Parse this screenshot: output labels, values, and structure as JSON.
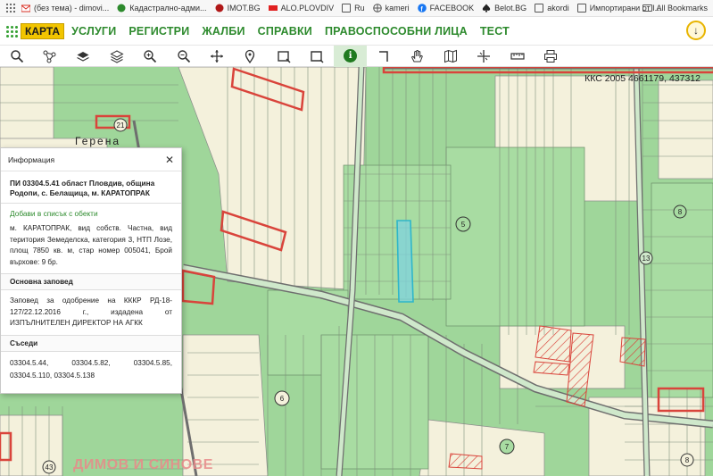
{
  "bookmarks": {
    "items": [
      {
        "label": "(без тема) - dimovi...",
        "icon": "gmail-icon"
      },
      {
        "label": "Кадастрално-адми...",
        "icon": "cadastre-icon"
      },
      {
        "label": "IMOT.BG",
        "icon": "imot-icon"
      },
      {
        "label": "ALO.PLOVDIV",
        "icon": "alo-icon"
      },
      {
        "label": "Ru",
        "icon": "folder-icon"
      },
      {
        "label": "kameri",
        "icon": "globe-icon"
      },
      {
        "label": "FACEBOOK",
        "icon": "facebook-icon"
      },
      {
        "label": "Belot.BG",
        "icon": "spade-icon"
      },
      {
        "label": "akordi",
        "icon": "folder-icon"
      },
      {
        "label": "Импортирани от I...",
        "icon": "folder-icon"
      }
    ],
    "all_label": "All Bookmarks"
  },
  "nav": {
    "logo": "КАРТА",
    "items": [
      "УСЛУГИ",
      "РЕГИСТРИ",
      "ЖАЛБИ",
      "СПРАВКИ",
      "ПРАВОСПОСОБНИ ЛИЦА",
      "ТЕСТ"
    ]
  },
  "toolbar": {
    "tools": [
      "search-icon",
      "network-icon",
      "layers-icon",
      "layers-stack-icon",
      "zoom-in-icon",
      "zoom-out-icon",
      "pan-icon",
      "pin-icon",
      "select-rect-icon",
      "select-polygon-icon",
      "info-icon",
      "measure-angle-icon",
      "hand-icon",
      "map-icon",
      "crosshair-icon",
      "ruler-icon",
      "print-icon"
    ],
    "active_tool": "info-icon"
  },
  "map": {
    "coords": "ККС 2005 4661179, 437312",
    "place": "Герена",
    "bottom_label": "ДИМОВ И СИНОВЕ",
    "parcel_numbers": [
      "21",
      "5",
      "8",
      "13",
      "6",
      "7",
      "43",
      "8"
    ]
  },
  "info_panel": {
    "title": "Информация",
    "heading": "ПИ 03304.5.41 област Пловдив, община Родопи, с. Белащица, м. КАРАТОПРАК",
    "add_link": "Добави в списък с обекти",
    "description": "м. КАРАТОПРАК, вид собств. Частна, вид територия Земеделска, категория 3, НТП Лозе, площ 7850 кв. м, стар номер 005041, Брой върхове: 9 бр.",
    "order_title": "Основна заповед",
    "order_text": "Заповед за одобрение на КККР РД-18-127/22.12.2016 г., издадена от ИЗПЪЛНИТЕЛЕН ДИРЕКТОР НА АГКК",
    "neighbors_title": "Съседи",
    "neighbors": [
      "03304.5.44,",
      "03304.5.82,",
      "03304.5.85,",
      "03304.5.110,",
      "03304.5.138"
    ]
  },
  "colors": {
    "nav_green": "#2d8a2d",
    "map_green": "#9fd69a",
    "map_beige": "#f4f1dc",
    "parcel_red": "#d9443b",
    "selection_cyan": "#2fb6c9"
  }
}
